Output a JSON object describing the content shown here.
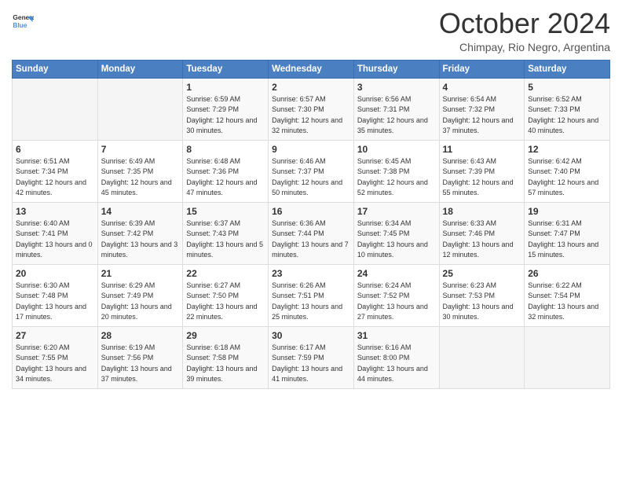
{
  "header": {
    "logo_line1": "General",
    "logo_line2": "Blue",
    "month_title": "October 2024",
    "location": "Chimpay, Rio Negro, Argentina"
  },
  "days_of_week": [
    "Sunday",
    "Monday",
    "Tuesday",
    "Wednesday",
    "Thursday",
    "Friday",
    "Saturday"
  ],
  "weeks": [
    [
      {
        "day": "",
        "sunrise": "",
        "sunset": "",
        "daylight": ""
      },
      {
        "day": "",
        "sunrise": "",
        "sunset": "",
        "daylight": ""
      },
      {
        "day": "1",
        "sunrise": "Sunrise: 6:59 AM",
        "sunset": "Sunset: 7:29 PM",
        "daylight": "Daylight: 12 hours and 30 minutes."
      },
      {
        "day": "2",
        "sunrise": "Sunrise: 6:57 AM",
        "sunset": "Sunset: 7:30 PM",
        "daylight": "Daylight: 12 hours and 32 minutes."
      },
      {
        "day": "3",
        "sunrise": "Sunrise: 6:56 AM",
        "sunset": "Sunset: 7:31 PM",
        "daylight": "Daylight: 12 hours and 35 minutes."
      },
      {
        "day": "4",
        "sunrise": "Sunrise: 6:54 AM",
        "sunset": "Sunset: 7:32 PM",
        "daylight": "Daylight: 12 hours and 37 minutes."
      },
      {
        "day": "5",
        "sunrise": "Sunrise: 6:52 AM",
        "sunset": "Sunset: 7:33 PM",
        "daylight": "Daylight: 12 hours and 40 minutes."
      }
    ],
    [
      {
        "day": "6",
        "sunrise": "Sunrise: 6:51 AM",
        "sunset": "Sunset: 7:34 PM",
        "daylight": "Daylight: 12 hours and 42 minutes."
      },
      {
        "day": "7",
        "sunrise": "Sunrise: 6:49 AM",
        "sunset": "Sunset: 7:35 PM",
        "daylight": "Daylight: 12 hours and 45 minutes."
      },
      {
        "day": "8",
        "sunrise": "Sunrise: 6:48 AM",
        "sunset": "Sunset: 7:36 PM",
        "daylight": "Daylight: 12 hours and 47 minutes."
      },
      {
        "day": "9",
        "sunrise": "Sunrise: 6:46 AM",
        "sunset": "Sunset: 7:37 PM",
        "daylight": "Daylight: 12 hours and 50 minutes."
      },
      {
        "day": "10",
        "sunrise": "Sunrise: 6:45 AM",
        "sunset": "Sunset: 7:38 PM",
        "daylight": "Daylight: 12 hours and 52 minutes."
      },
      {
        "day": "11",
        "sunrise": "Sunrise: 6:43 AM",
        "sunset": "Sunset: 7:39 PM",
        "daylight": "Daylight: 12 hours and 55 minutes."
      },
      {
        "day": "12",
        "sunrise": "Sunrise: 6:42 AM",
        "sunset": "Sunset: 7:40 PM",
        "daylight": "Daylight: 12 hours and 57 minutes."
      }
    ],
    [
      {
        "day": "13",
        "sunrise": "Sunrise: 6:40 AM",
        "sunset": "Sunset: 7:41 PM",
        "daylight": "Daylight: 13 hours and 0 minutes."
      },
      {
        "day": "14",
        "sunrise": "Sunrise: 6:39 AM",
        "sunset": "Sunset: 7:42 PM",
        "daylight": "Daylight: 13 hours and 3 minutes."
      },
      {
        "day": "15",
        "sunrise": "Sunrise: 6:37 AM",
        "sunset": "Sunset: 7:43 PM",
        "daylight": "Daylight: 13 hours and 5 minutes."
      },
      {
        "day": "16",
        "sunrise": "Sunrise: 6:36 AM",
        "sunset": "Sunset: 7:44 PM",
        "daylight": "Daylight: 13 hours and 7 minutes."
      },
      {
        "day": "17",
        "sunrise": "Sunrise: 6:34 AM",
        "sunset": "Sunset: 7:45 PM",
        "daylight": "Daylight: 13 hours and 10 minutes."
      },
      {
        "day": "18",
        "sunrise": "Sunrise: 6:33 AM",
        "sunset": "Sunset: 7:46 PM",
        "daylight": "Daylight: 13 hours and 12 minutes."
      },
      {
        "day": "19",
        "sunrise": "Sunrise: 6:31 AM",
        "sunset": "Sunset: 7:47 PM",
        "daylight": "Daylight: 13 hours and 15 minutes."
      }
    ],
    [
      {
        "day": "20",
        "sunrise": "Sunrise: 6:30 AM",
        "sunset": "Sunset: 7:48 PM",
        "daylight": "Daylight: 13 hours and 17 minutes."
      },
      {
        "day": "21",
        "sunrise": "Sunrise: 6:29 AM",
        "sunset": "Sunset: 7:49 PM",
        "daylight": "Daylight: 13 hours and 20 minutes."
      },
      {
        "day": "22",
        "sunrise": "Sunrise: 6:27 AM",
        "sunset": "Sunset: 7:50 PM",
        "daylight": "Daylight: 13 hours and 22 minutes."
      },
      {
        "day": "23",
        "sunrise": "Sunrise: 6:26 AM",
        "sunset": "Sunset: 7:51 PM",
        "daylight": "Daylight: 13 hours and 25 minutes."
      },
      {
        "day": "24",
        "sunrise": "Sunrise: 6:24 AM",
        "sunset": "Sunset: 7:52 PM",
        "daylight": "Daylight: 13 hours and 27 minutes."
      },
      {
        "day": "25",
        "sunrise": "Sunrise: 6:23 AM",
        "sunset": "Sunset: 7:53 PM",
        "daylight": "Daylight: 13 hours and 30 minutes."
      },
      {
        "day": "26",
        "sunrise": "Sunrise: 6:22 AM",
        "sunset": "Sunset: 7:54 PM",
        "daylight": "Daylight: 13 hours and 32 minutes."
      }
    ],
    [
      {
        "day": "27",
        "sunrise": "Sunrise: 6:20 AM",
        "sunset": "Sunset: 7:55 PM",
        "daylight": "Daylight: 13 hours and 34 minutes."
      },
      {
        "day": "28",
        "sunrise": "Sunrise: 6:19 AM",
        "sunset": "Sunset: 7:56 PM",
        "daylight": "Daylight: 13 hours and 37 minutes."
      },
      {
        "day": "29",
        "sunrise": "Sunrise: 6:18 AM",
        "sunset": "Sunset: 7:58 PM",
        "daylight": "Daylight: 13 hours and 39 minutes."
      },
      {
        "day": "30",
        "sunrise": "Sunrise: 6:17 AM",
        "sunset": "Sunset: 7:59 PM",
        "daylight": "Daylight: 13 hours and 41 minutes."
      },
      {
        "day": "31",
        "sunrise": "Sunrise: 6:16 AM",
        "sunset": "Sunset: 8:00 PM",
        "daylight": "Daylight: 13 hours and 44 minutes."
      },
      {
        "day": "",
        "sunrise": "",
        "sunset": "",
        "daylight": ""
      },
      {
        "day": "",
        "sunrise": "",
        "sunset": "",
        "daylight": ""
      }
    ]
  ]
}
